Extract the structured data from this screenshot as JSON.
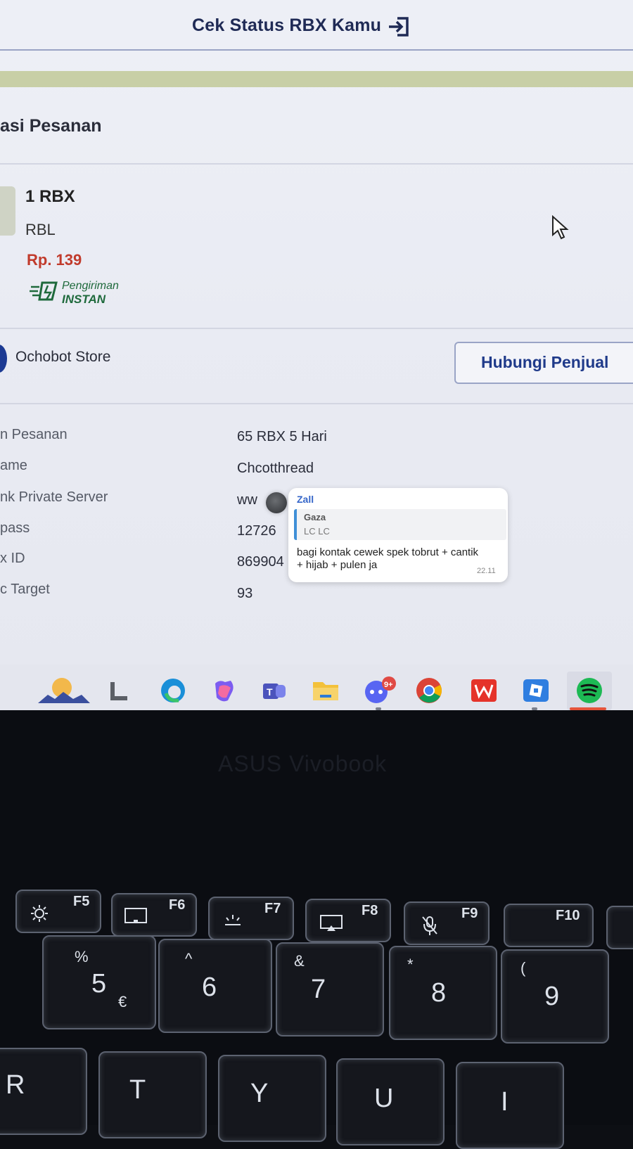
{
  "header": {
    "title": "Cek Status RBX Kamu",
    "exit_icon": "exit-arrow-icon"
  },
  "section": {
    "title": "asi Pesanan"
  },
  "product": {
    "name": "1 RBX",
    "category": "RBL",
    "price": "Rp. 139",
    "shipping_line1": "Pengiriman",
    "shipping_line2": "INSTAN"
  },
  "store": {
    "name": "Ochobot Store",
    "contact_label": "Hubungi Penjual"
  },
  "details": [
    {
      "label": "n Pesanan",
      "value": "65 RBX 5 Hari"
    },
    {
      "label": "ame",
      "value": "Chcotthread"
    },
    {
      "label": "nk Private Server",
      "value": "ww"
    },
    {
      "label": "pass",
      "value": "12726"
    },
    {
      "label": "x ID",
      "value": "869904"
    },
    {
      "label": "c Target",
      "value": "93"
    }
  ],
  "notification": {
    "sender": "Zall",
    "quote_name": "Gaza",
    "quote_text": "LC LC",
    "message": "bagi kontak cewek spek tobrut + cantik + hijab + pulen ja",
    "time": "22.11"
  },
  "taskbar": {
    "apps": [
      "weather-widget-icon",
      "file-icon",
      "edge-icon",
      "copilot-icon",
      "teams-icon",
      "file-explorer-icon",
      "discord-icon",
      "chrome-icon",
      "wps-office-icon",
      "roblox-icon",
      "spotify-icon"
    ],
    "discord_badge": "9+"
  },
  "laptop": {
    "brand": "ASUS Vivobook",
    "fkeys": [
      "F5",
      "F6",
      "F7",
      "F8",
      "F9",
      "F10"
    ],
    "num_keys": [
      {
        "main": "5",
        "shift": "%",
        "alt": "€"
      },
      {
        "main": "6",
        "shift": "^",
        "alt": ""
      },
      {
        "main": "7",
        "shift": "&",
        "alt": ""
      },
      {
        "main": "8",
        "shift": "*",
        "alt": ""
      },
      {
        "main": "9",
        "shift": "(",
        "alt": ""
      }
    ],
    "letter_keys": [
      "R",
      "T",
      "Y",
      "U",
      "I"
    ]
  }
}
